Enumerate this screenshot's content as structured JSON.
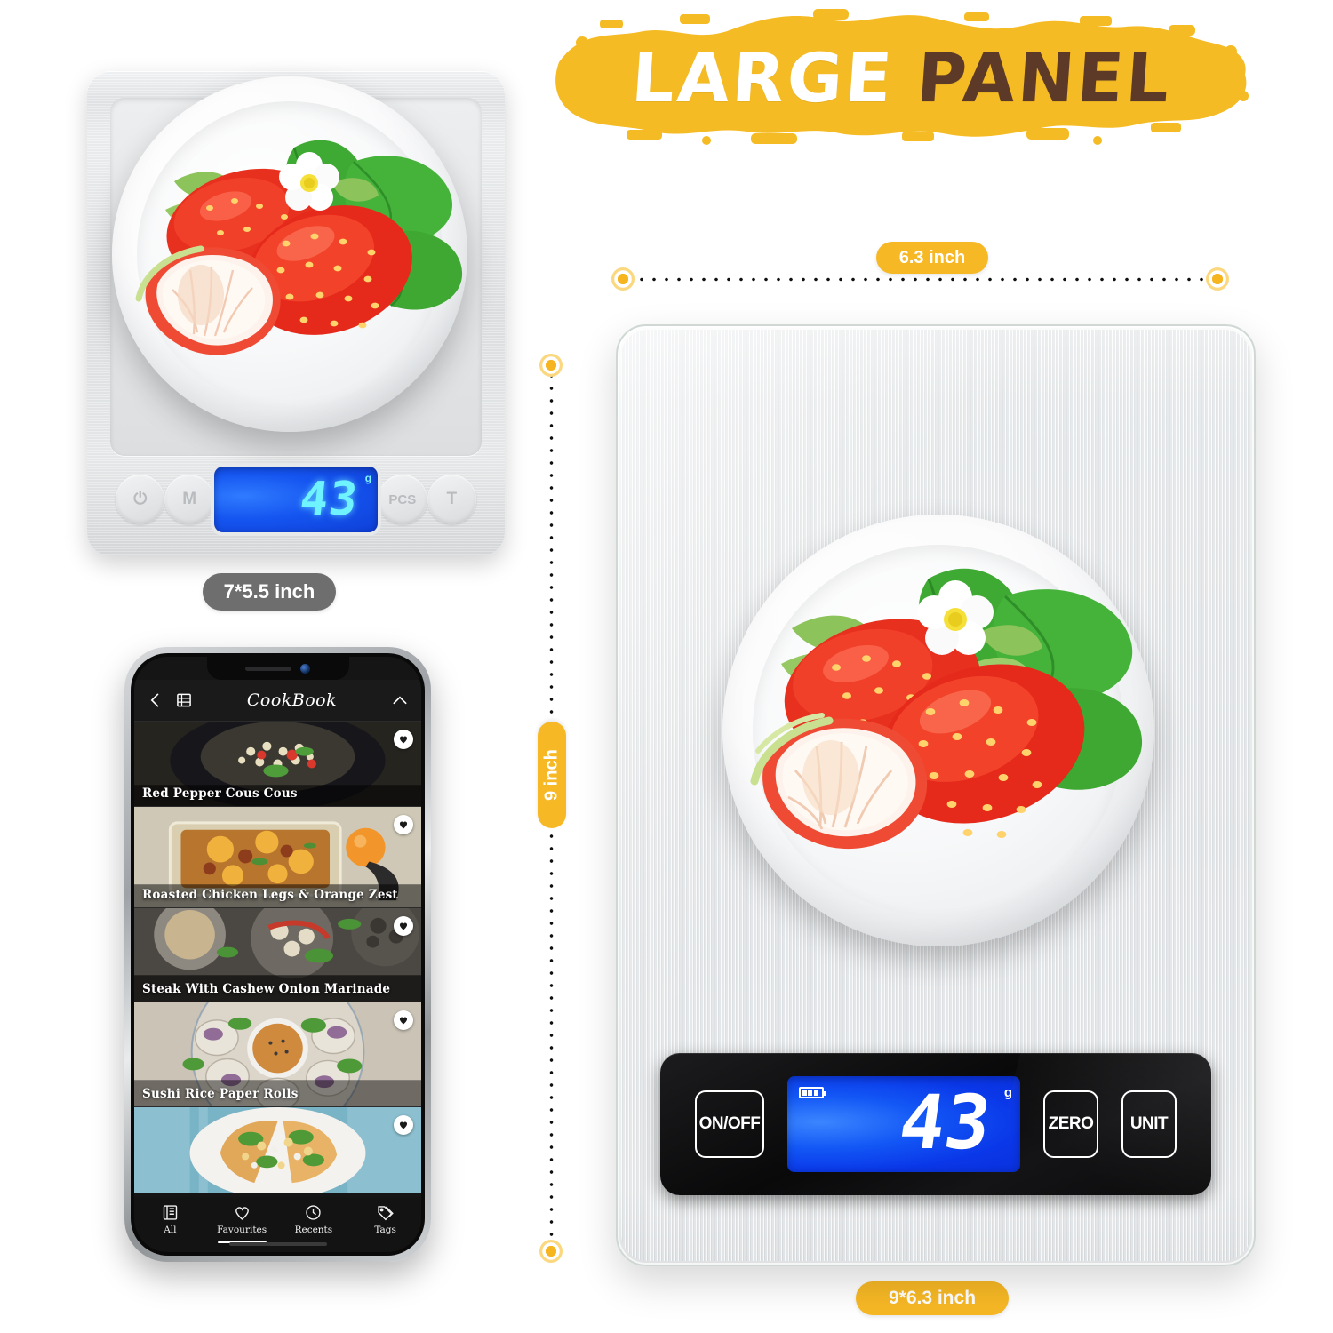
{
  "title": {
    "word_1": "LARGE",
    "word_2": "PANEL",
    "banner_color": "#f5bb24",
    "word_1_color": "#ffffff",
    "word_2_color": "#5d3a28"
  },
  "dimensions": {
    "width_label": "6.3 inch",
    "height_label": "9 inch",
    "overall_label": "9*6.3 inch",
    "mini_scale_label": "7*5.5 inch",
    "pill_color": "#f7b825",
    "mini_pill_color": "#6e6e6e"
  },
  "mini_scale": {
    "display_value": "43",
    "display_unit": "g",
    "buttons": [
      {
        "name": "power",
        "label": "⏻"
      },
      {
        "name": "mode",
        "label": "M"
      },
      {
        "name": "pieces",
        "label": "PCS"
      },
      {
        "name": "tare",
        "label": "T"
      }
    ],
    "lcd_color": "#1555f0",
    "digit_color": "#6ff4ff"
  },
  "big_scale": {
    "display_value": "43",
    "display_unit": "g",
    "onoff_label": "ON/OFF",
    "zero_label": "ZERO",
    "unit_label": "UNIT",
    "lcd_color": "#0a37e8",
    "digit_color": "#ffffff",
    "panel_color": "#0b0b0c",
    "body_color": "#e6e8ea"
  },
  "phone": {
    "app_title": "CookBook",
    "nav_back_icon": "chevron-left-icon",
    "nav_grid_icon": "grid-icon",
    "nav_collapse_icon": "chevron-up-icon",
    "recipes": [
      {
        "title": "Red Pepper Cous Cous",
        "favourite_icon": "heart-icon"
      },
      {
        "title": "Roasted Chicken Legs & Orange Zest",
        "favourite_icon": "heart-icon"
      },
      {
        "title": "Steak With Cashew Onion Marinade",
        "favourite_icon": "heart-icon"
      },
      {
        "title": "Sushi Rice Paper Rolls",
        "favourite_icon": "heart-icon"
      },
      {
        "title": "",
        "favourite_icon": "heart-icon"
      }
    ],
    "tabs": [
      {
        "label": "All",
        "icon": "book-icon",
        "active": false
      },
      {
        "label": "Favourites",
        "icon": "heart-icon",
        "active": true
      },
      {
        "label": "Recents",
        "icon": "clock-icon",
        "active": false
      },
      {
        "label": "Tags",
        "icon": "tags-icon",
        "active": false
      }
    ]
  },
  "product_photo": {
    "subject": "white bowl with strawberries",
    "items": "2 whole strawberries, 1 halved strawberry, green leaves, white flower"
  }
}
